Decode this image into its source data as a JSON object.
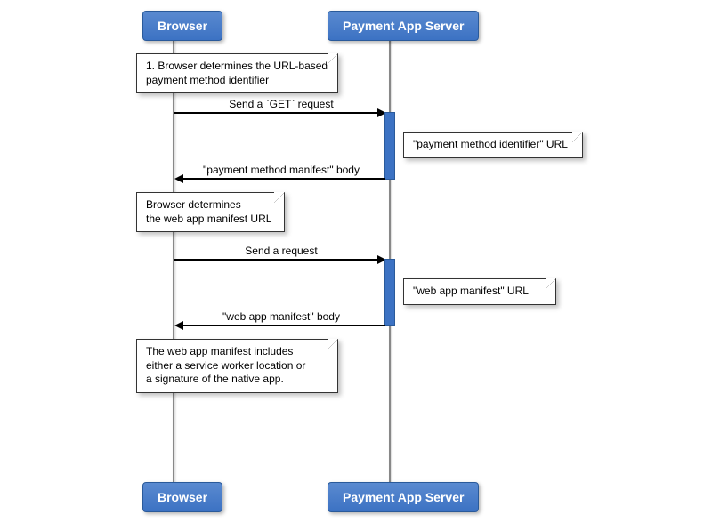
{
  "participants": {
    "left": "Browser",
    "right": "Payment App Server"
  },
  "notes": {
    "n1": "1. Browser determines the URL-based\npayment method identifier",
    "n2": "\"payment method identifier\" URL",
    "n3": "Browser determines\nthe web app manifest URL",
    "n4": "\"web app manifest\" URL",
    "n5": "The web app manifest includes\neither a service worker location or\na signature of the native app."
  },
  "messages": {
    "m1": "Send a `GET` request",
    "m2": "\"payment method manifest\" body",
    "m3": "Send a request",
    "m4": "\"web app manifest\" body"
  },
  "chart_data": {
    "type": "sequence-diagram",
    "participants": [
      "Browser",
      "Payment App Server"
    ],
    "steps": [
      {
        "type": "note",
        "over": "Browser",
        "text": "1. Browser determines the URL-based payment method identifier"
      },
      {
        "type": "message",
        "from": "Browser",
        "to": "Payment App Server",
        "label": "Send a `GET` request"
      },
      {
        "type": "note",
        "over": "Payment App Server",
        "text": "\"payment method identifier\" URL"
      },
      {
        "type": "message",
        "from": "Payment App Server",
        "to": "Browser",
        "label": "\"payment method manifest\" body"
      },
      {
        "type": "note",
        "over": "Browser",
        "text": "Browser determines the web app manifest URL"
      },
      {
        "type": "message",
        "from": "Browser",
        "to": "Payment App Server",
        "label": "Send a request"
      },
      {
        "type": "note",
        "over": "Payment App Server",
        "text": "\"web app manifest\" URL"
      },
      {
        "type": "message",
        "from": "Payment App Server",
        "to": "Browser",
        "label": "\"web app manifest\" body"
      },
      {
        "type": "note",
        "over": "Browser",
        "text": "The web app manifest includes either a service worker location or a signature of the native app."
      }
    ]
  }
}
